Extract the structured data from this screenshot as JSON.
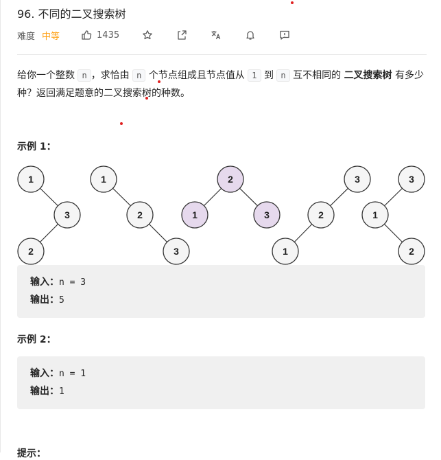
{
  "problem": {
    "title": "96. 不同的二叉搜索树",
    "difficulty_label": "难度",
    "difficulty_value": "中等",
    "likes": "1435",
    "icons": [
      "thumbs-up-icon",
      "star-icon",
      "share-icon",
      "translate-icon",
      "bell-icon",
      "feedback-icon"
    ]
  },
  "description": {
    "p1": "给你一个整数",
    "code_n1": "n",
    "p2": "，求恰由",
    "code_n2": "n",
    "p3": "个节点组成且节点值从",
    "code_1": "1",
    "p4": "到",
    "code_n3": "n",
    "p5": "互不相同的",
    "bold": "二叉搜索树",
    "p6": "有多少种？返回满足题意的二叉搜索树的种数。"
  },
  "example1": {
    "heading": "示例 1：",
    "trees": [
      {
        "nodes": [
          {
            "v": "1"
          },
          {
            "v": "3"
          },
          {
            "v": "2"
          }
        ],
        "highlight": false
      },
      {
        "nodes": [
          {
            "v": "1"
          },
          {
            "v": "2"
          },
          {
            "v": "3"
          }
        ],
        "highlight": false
      },
      {
        "nodes": [
          {
            "v": "2"
          },
          {
            "v": "1"
          },
          {
            "v": "3"
          }
        ],
        "highlight": true
      },
      {
        "nodes": [
          {
            "v": "3"
          },
          {
            "v": "2"
          },
          {
            "v": "1"
          }
        ],
        "highlight": false
      },
      {
        "nodes": [
          {
            "v": "3"
          },
          {
            "v": "1"
          },
          {
            "v": "2"
          }
        ],
        "highlight": false
      }
    ],
    "input_label": "输入：",
    "input_value": "n = 3",
    "output_label": "输出：",
    "output_value": "5"
  },
  "example2": {
    "heading": "示例 2：",
    "input_label": "输入：",
    "input_value": "n = 1",
    "output_label": "输出：",
    "output_value": "1"
  },
  "next_section": "提示："
}
